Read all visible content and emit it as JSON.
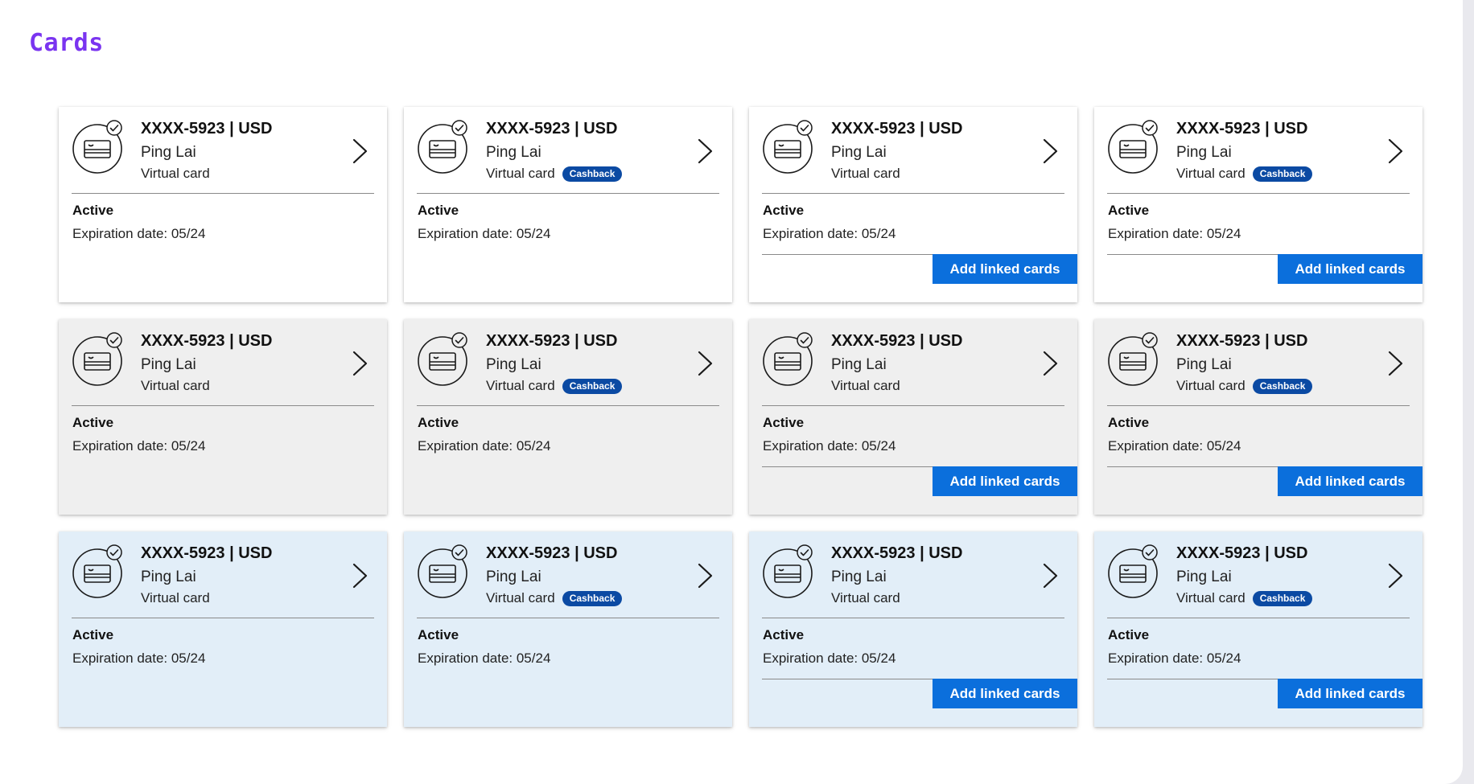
{
  "page": {
    "title": "Cards"
  },
  "colors": {
    "title_accent": "#7a34f0",
    "card_default": "#ffffff",
    "card_hover": "#efefef",
    "card_selected": "#e2eef8",
    "badge_bg": "#0b4aa3",
    "button_bg": "#0b6fdc"
  },
  "icons": {
    "card": "credit-card-icon",
    "check": "check-badge-icon",
    "chevron": "chevron-right-icon"
  },
  "cards": [
    {
      "variant": "default",
      "number": "XXXX-5923 | USD",
      "name": "Ping Lai",
      "type": "Virtual card",
      "badge": "",
      "status": "Active",
      "expiration": "Expiration date: 05/24",
      "action": ""
    },
    {
      "variant": "default",
      "number": "XXXX-5923 | USD",
      "name": "Ping Lai",
      "type": "Virtual card",
      "badge": "Cashback",
      "status": "Active",
      "expiration": "Expiration date: 05/24",
      "action": ""
    },
    {
      "variant": "default",
      "number": "XXXX-5923 | USD",
      "name": "Ping Lai",
      "type": "Virtual card",
      "badge": "",
      "status": "Active",
      "expiration": "Expiration date: 05/24",
      "action": "Add linked cards"
    },
    {
      "variant": "default",
      "number": "XXXX-5923 | USD",
      "name": "Ping Lai",
      "type": "Virtual card",
      "badge": "Cashback",
      "status": "Active",
      "expiration": "Expiration date: 05/24",
      "action": "Add linked cards"
    },
    {
      "variant": "hover",
      "number": "XXXX-5923 | USD",
      "name": "Ping Lai",
      "type": "Virtual card",
      "badge": "",
      "status": "Active",
      "expiration": "Expiration date: 05/24",
      "action": ""
    },
    {
      "variant": "hover",
      "number": "XXXX-5923 | USD",
      "name": "Ping Lai",
      "type": "Virtual card",
      "badge": "Cashback",
      "status": "Active",
      "expiration": "Expiration date: 05/24",
      "action": ""
    },
    {
      "variant": "hover",
      "number": "XXXX-5923 | USD",
      "name": "Ping Lai",
      "type": "Virtual card",
      "badge": "",
      "status": "Active",
      "expiration": "Expiration date: 05/24",
      "action": "Add linked cards"
    },
    {
      "variant": "hover",
      "number": "XXXX-5923 | USD",
      "name": "Ping Lai",
      "type": "Virtual card",
      "badge": "Cashback",
      "status": "Active",
      "expiration": "Expiration date: 05/24",
      "action": "Add linked cards"
    },
    {
      "variant": "selected",
      "number": "XXXX-5923 | USD",
      "name": "Ping Lai",
      "type": "Virtual card",
      "badge": "",
      "status": "Active",
      "expiration": "Expiration date: 05/24",
      "action": ""
    },
    {
      "variant": "selected",
      "number": "XXXX-5923 | USD",
      "name": "Ping Lai",
      "type": "Virtual card",
      "badge": "Cashback",
      "status": "Active",
      "expiration": "Expiration date: 05/24",
      "action": ""
    },
    {
      "variant": "selected",
      "number": "XXXX-5923 | USD",
      "name": "Ping Lai",
      "type": "Virtual card",
      "badge": "",
      "status": "Active",
      "expiration": "Expiration date: 05/24",
      "action": "Add linked cards"
    },
    {
      "variant": "selected",
      "number": "XXXX-5923 | USD",
      "name": "Ping Lai",
      "type": "Virtual card",
      "badge": "Cashback",
      "status": "Active",
      "expiration": "Expiration date: 05/24",
      "action": "Add linked cards"
    }
  ]
}
